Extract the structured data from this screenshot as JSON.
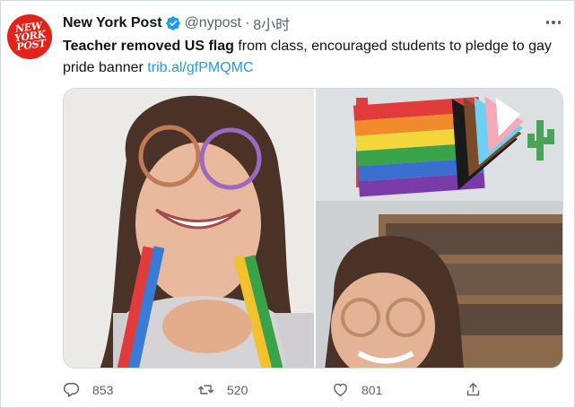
{
  "tweet": {
    "avatar_text": "NEW YORK POST",
    "author_name": "New York Post",
    "verified": true,
    "handle": "@nypost",
    "separator": "·",
    "time": "8小时",
    "text_bold": "Teacher removed US flag",
    "text_rest": " from class, encouraged students to pledge to gay pride banner ",
    "link": "trib.al/gfPMQMC",
    "media": [
      {
        "name": "photo-teacher-rainbow-glasses"
      },
      {
        "name": "photo-classroom-pride-flag"
      }
    ],
    "actions": {
      "replies": "853",
      "retweets": "520",
      "likes": "801"
    }
  },
  "colors": {
    "text": "#0f1419",
    "secondary": "#536471",
    "link": "#1d9bf0",
    "verified": "#1d9bf0",
    "brand": "#e2231a",
    "border": "#cfd9de"
  }
}
